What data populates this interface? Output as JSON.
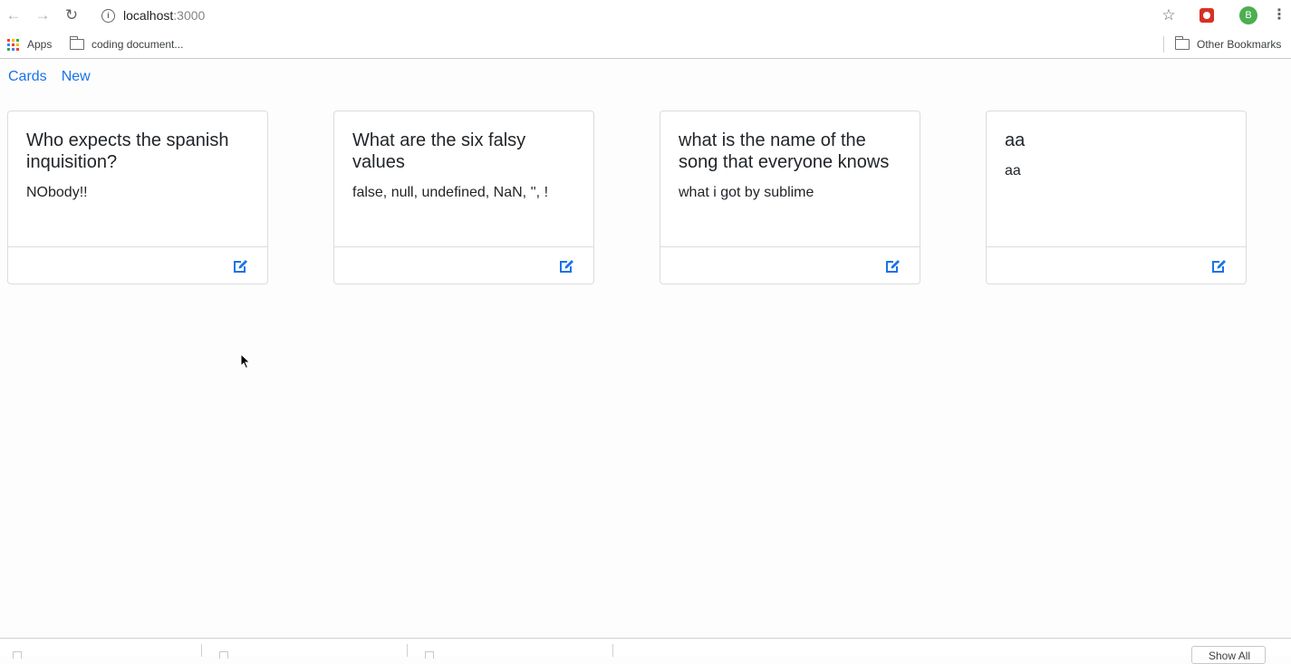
{
  "browser": {
    "url_host": "localhost",
    "url_port": ":3000",
    "avatar_letter": "B",
    "bookmarks": [
      {
        "label": "Apps"
      },
      {
        "label": "coding document..."
      }
    ],
    "other_bookmarks": "Other Bookmarks",
    "shelf_button_label": "Show All"
  },
  "nav": {
    "links": [
      "Cards",
      "New"
    ]
  },
  "cards": [
    {
      "title": "Who expects the spanish inquisition?",
      "text": "NObody!!"
    },
    {
      "title": "What are the six falsy values",
      "text": "false, null, undefined, NaN, '', !"
    },
    {
      "title": "what is the name of the song that everyone knows",
      "text": "what i got by sublime"
    },
    {
      "title": "aa",
      "text": "aa"
    }
  ],
  "colors": {
    "link": "#1a73e8",
    "edit_icon": "#1a73e8",
    "card_border": "#dcdcdc"
  }
}
